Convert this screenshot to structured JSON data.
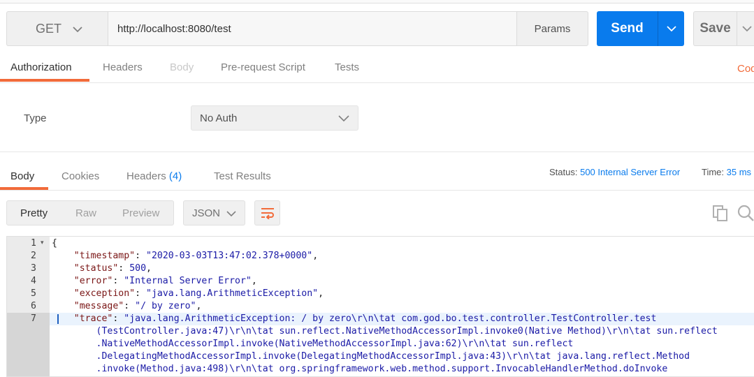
{
  "request": {
    "method": "GET",
    "url": "http://localhost:8080/test",
    "params_label": "Params",
    "send_label": "Send",
    "save_label": "Save"
  },
  "request_tabs": [
    "Authorization",
    "Headers",
    "Body",
    "Pre-request Script",
    "Tests"
  ],
  "code_link": "Code",
  "auth": {
    "type_label": "Type",
    "type_value": "No Auth"
  },
  "response_tabs": {
    "body": "Body",
    "cookies": "Cookies",
    "headers": "Headers",
    "headers_count": "(4)",
    "test_results": "Test Results"
  },
  "status": {
    "label": "Status:",
    "value": "500 Internal Server Error",
    "time_label": "Time:",
    "time_value": "35 ms"
  },
  "view_modes": [
    "Pretty",
    "Raw",
    "Preview"
  ],
  "format": "JSON",
  "body_lines": {
    "l1": "{",
    "timestamp_key": "\"timestamp\"",
    "timestamp_val": "\"2020-03-03T13:47:02.378+0000\"",
    "status_key": "\"status\"",
    "status_val": "500",
    "error_key": "\"error\"",
    "error_val": "\"Internal Server Error\"",
    "exception_key": "\"exception\"",
    "exception_val": "\"java.lang.ArithmeticException\"",
    "message_key": "\"message\"",
    "message_val": "\"/ by zero\"",
    "trace_key": "\"trace\"",
    "trace_wrap": [
      "\"java.lang.ArithmeticException: / by zero\\r\\n\\tat com.god.bo.test.controller.TestController.test",
      "(TestController.java:47)\\r\\n\\tat sun.reflect.NativeMethodAccessorImpl.invoke0(Native Method)\\r\\n\\tat sun.reflect",
      ".NativeMethodAccessorImpl.invoke(NativeMethodAccessorImpl.java:62)\\r\\n\\tat sun.reflect",
      ".DelegatingMethodAccessorImpl.invoke(DelegatingMethodAccessorImpl.java:43)\\r\\n\\tat java.lang.reflect.Method",
      ".invoke(Method.java:498)\\r\\n\\tat org.springframework.web.method.support.InvocableHandlerMethod.doInvoke"
    ]
  },
  "line_numbers": [
    "1",
    "2",
    "3",
    "4",
    "5",
    "6",
    "7"
  ],
  "colors": {
    "accent": "#f26b3a",
    "primary": "#097bed"
  }
}
